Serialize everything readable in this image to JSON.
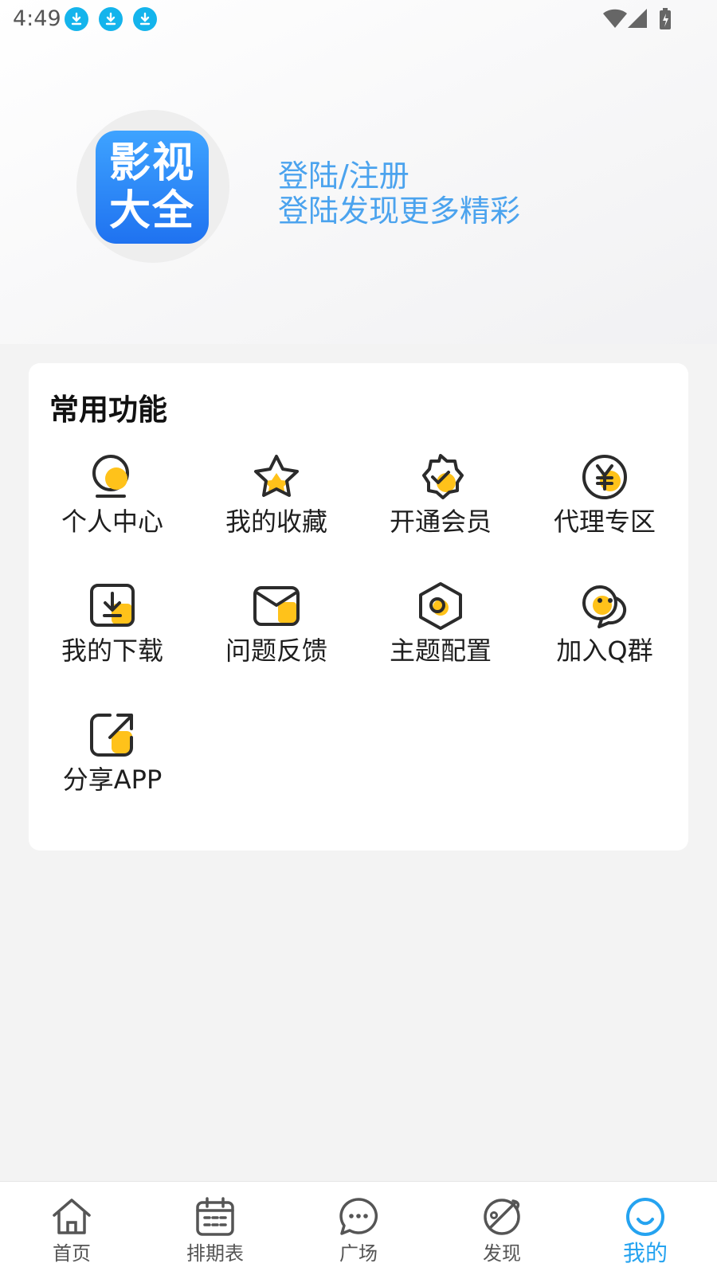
{
  "status_bar": {
    "time": "4:49"
  },
  "header": {
    "logo_line1": "影视",
    "logo_line2": "大全",
    "login_title": "登陆/注册",
    "login_subtitle": "登陆发现更多精彩"
  },
  "section": {
    "title": "常用功能",
    "items": [
      {
        "label": "个人中心",
        "icon": "user-icon"
      },
      {
        "label": "我的收藏",
        "icon": "star-icon"
      },
      {
        "label": "开通会员",
        "icon": "badge-check-icon"
      },
      {
        "label": "代理专区",
        "icon": "yen-icon"
      },
      {
        "label": "我的下载",
        "icon": "download-icon"
      },
      {
        "label": "问题反馈",
        "icon": "mail-icon"
      },
      {
        "label": "主题配置",
        "icon": "hex-theme-icon"
      },
      {
        "label": "加入Q群",
        "icon": "chat-group-icon"
      },
      {
        "label": "分享APP",
        "icon": "share-icon"
      }
    ]
  },
  "nav": {
    "items": [
      {
        "label": "首页",
        "icon": "home-icon"
      },
      {
        "label": "排期表",
        "icon": "calendar-icon"
      },
      {
        "label": "广场",
        "icon": "chat-icon"
      },
      {
        "label": "发现",
        "icon": "planet-icon"
      },
      {
        "label": "我的",
        "icon": "smile-icon"
      }
    ],
    "active_index": 4
  },
  "colors": {
    "accent": "#25a3f0",
    "icon_yellow": "#ffc21a",
    "login_blue": "#4ba3ee"
  }
}
